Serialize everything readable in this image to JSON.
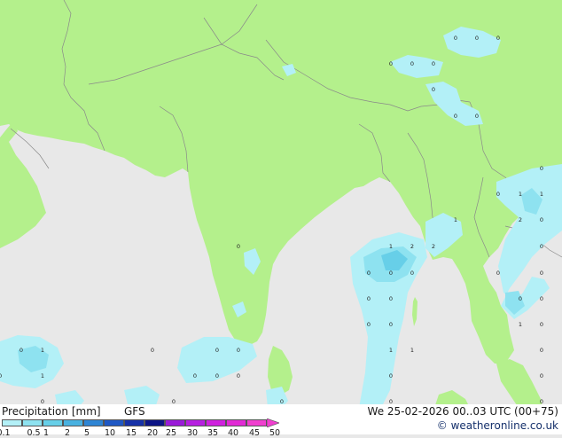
{
  "legend": {
    "title": "Precipitation [mm]",
    "model": "GFS",
    "datetime": "We 25-02-2026 00..03 UTC (00+75)",
    "website": "© weatheronline.co.uk",
    "scale": [
      {
        "label": "0.1",
        "color": "#f0f0f0"
      },
      {
        "label": "0.5",
        "color": "#b3f0f7"
      },
      {
        "label": "1",
        "color": "#8ee2f0"
      },
      {
        "label": "2",
        "color": "#67cfe8"
      },
      {
        "label": "5",
        "color": "#48b1e0"
      },
      {
        "label": "10",
        "color": "#2e85d4"
      },
      {
        "label": "15",
        "color": "#1f58c4"
      },
      {
        "label": "20",
        "color": "#1631a8"
      },
      {
        "label": "25",
        "color": "#0c1486"
      },
      {
        "label": "30",
        "color": "#9a1bd8"
      },
      {
        "label": "35",
        "color": "#b61fe0"
      },
      {
        "label": "40",
        "color": "#cf21de"
      },
      {
        "label": "45",
        "color": "#e12ad5"
      },
      {
        "label": "50",
        "color": "#f03fcf"
      }
    ]
  },
  "map": {
    "land_color": "#b4f08c",
    "sea_color": "#e8e8e8",
    "border_color": "#8a8a8a",
    "precip_light_color": "#b3f0f7",
    "precip_medium_color": "#8ee2f0",
    "precip_heavy_color": "#67cfe8",
    "value_labels": [
      "0",
      "0",
      "0",
      "0",
      "0",
      "0",
      "0",
      "0",
      "0",
      "0",
      "0",
      "1",
      "1",
      "1",
      "2",
      "0",
      "1",
      "2",
      "0",
      "2",
      "0",
      "0",
      "0",
      "0",
      "0",
      "0",
      "0",
      "0",
      "0",
      "0",
      "0",
      "0",
      "1",
      "0",
      "0",
      "1",
      "0",
      "0",
      "0",
      "1",
      "1",
      "0",
      "0",
      "1",
      "0",
      "0",
      "0",
      "0",
      "0",
      "0",
      "0",
      "0",
      "0",
      "0"
    ]
  }
}
